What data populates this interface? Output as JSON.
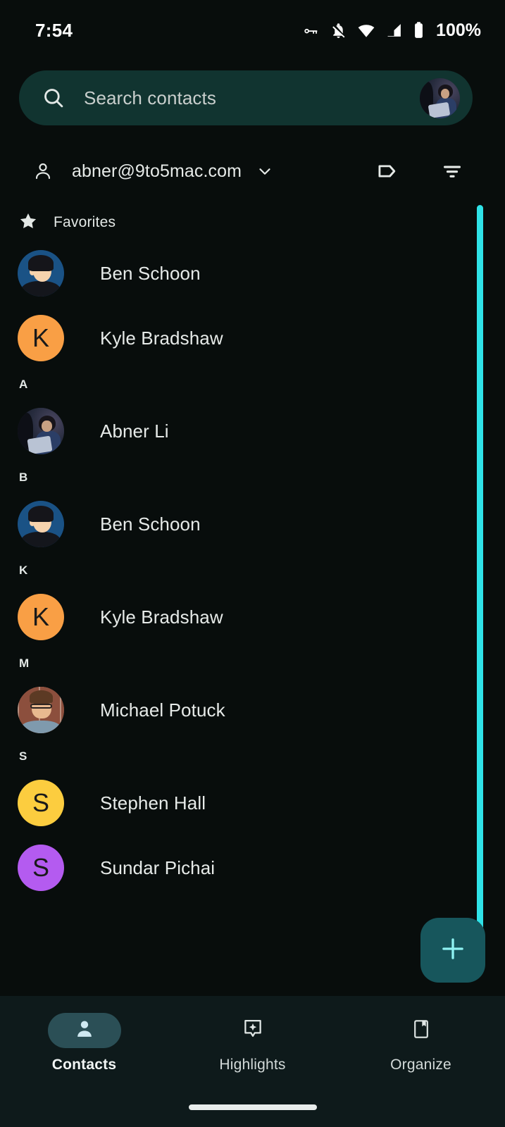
{
  "status_bar": {
    "time": "7:54",
    "battery_percent": "100%",
    "icons": [
      "key-icon",
      "notifications-off-icon",
      "wifi-icon",
      "cell-signal-icon",
      "battery-icon"
    ]
  },
  "search": {
    "placeholder": "Search contacts",
    "icon": "search-icon",
    "avatar_name": "Abner Li"
  },
  "account": {
    "email": "abner@9to5mac.com",
    "person_icon": "person-icon",
    "chevron_icon": "chevron-down-icon",
    "label_icon": "label-tag-icon",
    "filter_icon": "filter-icon"
  },
  "favorites": {
    "star_icon": "star-icon",
    "label": "Favorites",
    "contacts": [
      {
        "name": "Ben Schoon",
        "avatar_type": "photo-ben",
        "initial": "B",
        "color": "#1A5285"
      },
      {
        "name": "Kyle Bradshaw",
        "avatar_type": "initial",
        "initial": "K",
        "color": "#F99F45"
      }
    ]
  },
  "sections": [
    {
      "letter": "A",
      "contacts": [
        {
          "name": "Abner Li",
          "avatar_type": "photo-abner",
          "initial": "A",
          "color": "#2A2C3D"
        }
      ]
    },
    {
      "letter": "B",
      "contacts": [
        {
          "name": "Ben Schoon",
          "avatar_type": "photo-ben",
          "initial": "B",
          "color": "#1A5285"
        }
      ]
    },
    {
      "letter": "K",
      "contacts": [
        {
          "name": "Kyle Bradshaw",
          "avatar_type": "initial",
          "initial": "K",
          "color": "#F99F45"
        }
      ]
    },
    {
      "letter": "M",
      "contacts": [
        {
          "name": "Michael Potuck",
          "avatar_type": "photo-mike",
          "initial": "M",
          "color": "#8C4F3D"
        }
      ]
    },
    {
      "letter": "S",
      "contacts": [
        {
          "name": "Stephen Hall",
          "avatar_type": "initial",
          "initial": "S",
          "color": "#FCCD3F"
        },
        {
          "name": "Sundar Pichai",
          "avatar_type": "initial",
          "initial": "S",
          "color": "#B45BF0"
        }
      ]
    }
  ],
  "fab": {
    "icon": "plus-icon",
    "background": "#17565C",
    "icon_color": "#8FF2F2"
  },
  "scrollbar": {
    "color": "#2FE3E8"
  },
  "bottom_nav": {
    "items": [
      {
        "label": "Contacts",
        "icon": "person-filled-icon",
        "active": true
      },
      {
        "label": "Highlights",
        "icon": "sparkle-pin-icon",
        "active": false
      },
      {
        "label": "Organize",
        "icon": "bookmark-page-icon",
        "active": false
      }
    ],
    "active_pill_color": "#2B4F56"
  },
  "theme": {
    "background": "#080D0C",
    "search_background": "#113430",
    "nav_background": "#0E1A1B",
    "text_primary": "#E6EAE8",
    "accent": "#2FE3E8"
  }
}
